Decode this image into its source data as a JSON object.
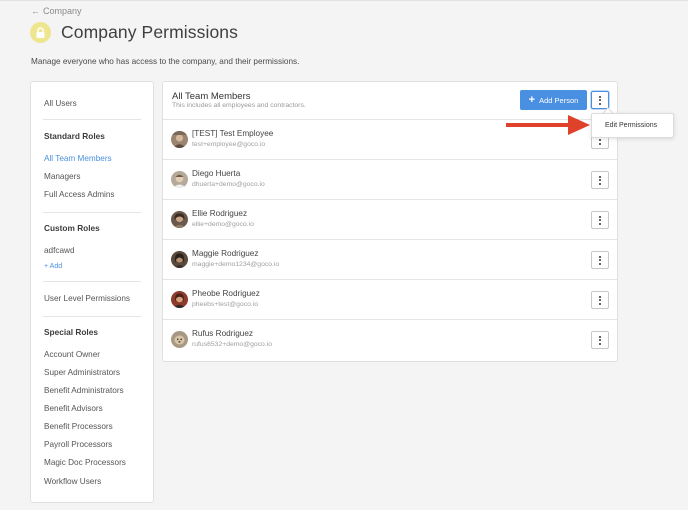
{
  "breadcrumb": {
    "arrow": "←",
    "label": "Company"
  },
  "header": {
    "title": "Company Permissions",
    "description": "Manage everyone who has access to the company, and their permissions.",
    "icon": "lock-icon",
    "icon_bg": "#eee58f"
  },
  "sidebar": {
    "all_users": "All Users",
    "standard_heading": "Standard Roles",
    "standard": [
      "All Team Members",
      "Managers",
      "Full Access Admins"
    ],
    "custom_heading": "Custom Roles",
    "custom": [
      "adfcawd"
    ],
    "add_label": "+ Add",
    "user_level": "User Level Permissions",
    "special_heading": "Special Roles",
    "special": [
      "Account Owner",
      "Super Administrators",
      "Benefit Administrators",
      "Benefit Advisors",
      "Benefit Processors",
      "Payroll Processors",
      "Magic Doc Processors",
      "Workflow Users"
    ]
  },
  "main": {
    "title": "All Team Members",
    "subtitle": "This includes all employees and contractors.",
    "add_button": "Add Person",
    "members": [
      {
        "name": "[TEST] Test Employee",
        "email": "test+employee@goco.io"
      },
      {
        "name": "Diego Huerta",
        "email": "dhuerta+demo@goco.io"
      },
      {
        "name": "Ellie Rodriguez",
        "email": "ellie+demo@goco.io"
      },
      {
        "name": "Maggie Rodriguez",
        "email": "maggie+demo1234@goco.io"
      },
      {
        "name": "Pheobe Rodriguez",
        "email": "pheebs+test@goco.io"
      },
      {
        "name": "Rufus Rodriguez",
        "email": "rufus6532+demo@goco.io"
      }
    ]
  },
  "dropdown": {
    "item": "Edit Permissions"
  },
  "colors": {
    "accent": "#4a90e2",
    "annotation_arrow": "#e0412b",
    "page_bg": "#f4f4f4"
  }
}
